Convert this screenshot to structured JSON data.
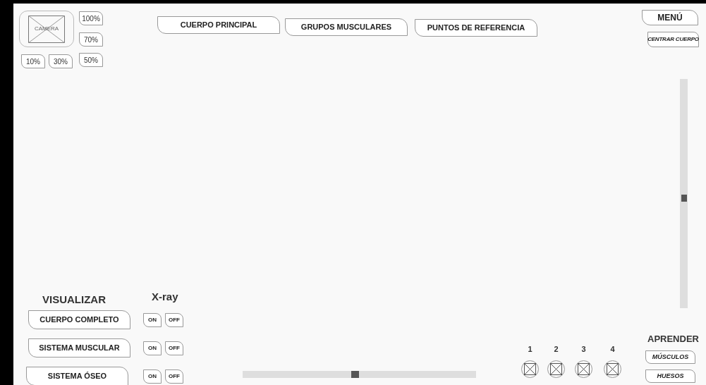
{
  "camera": {
    "label": "CAMERA"
  },
  "zoom_buttons": [
    "100%",
    "70%",
    "10%",
    "30%",
    "50%"
  ],
  "tabs": [
    {
      "label": "CUERPO PRINCIPAL"
    },
    {
      "label": "GRUPOS MUSCULARES"
    },
    {
      "label": "PUNTOS DE REFERENCIA"
    }
  ],
  "menu": {
    "label": "MENÚ"
  },
  "center_button": {
    "label": "CENTRAR CUERPO"
  },
  "vertical_slider": {
    "level": 0.48
  },
  "visualize": {
    "title": "VISUALIZAR",
    "xray_title": "X-ray",
    "rows": [
      {
        "label": "CUERPO COMPLETO",
        "on": "ON",
        "off": "OFF"
      },
      {
        "label": "SISTEMA MUSCULAR",
        "on": "ON",
        "off": "OFF"
      },
      {
        "label": "SISTEMA ÓSEO",
        "on": "ON",
        "off": "OFF"
      }
    ]
  },
  "timeline_slider": {
    "level": 0.48
  },
  "slots": [
    {
      "label": "1"
    },
    {
      "label": "2"
    },
    {
      "label": "3"
    },
    {
      "label": "4"
    }
  ],
  "learn": {
    "title": "APRENDER",
    "buttons": [
      "MÚSCULOS",
      "HUESOS"
    ]
  }
}
